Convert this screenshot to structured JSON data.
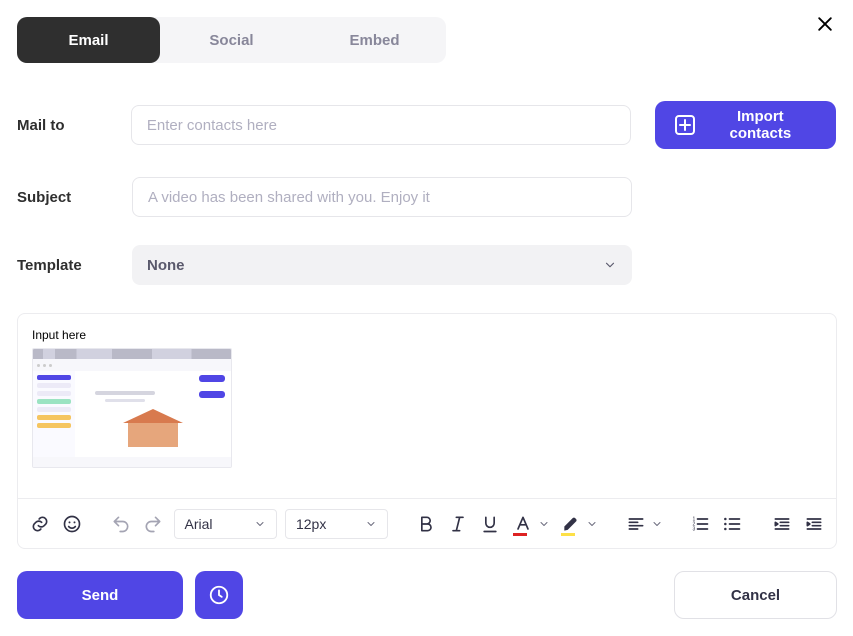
{
  "tabs": {
    "email": "Email",
    "social": "Social",
    "embed": "Embed"
  },
  "close_icon": "close",
  "form": {
    "mail_to_label": "Mail to",
    "mail_to_placeholder": "Enter contacts here",
    "import_button": "Import contacts",
    "subject_label": "Subject",
    "subject_placeholder": "A video has been shared with you. Enjoy it",
    "template_label": "Template",
    "template_selected": "None"
  },
  "editor": {
    "placeholder": "Input here",
    "font": "Arial",
    "size": "12px"
  },
  "actions": {
    "send": "Send",
    "cancel": "Cancel"
  }
}
